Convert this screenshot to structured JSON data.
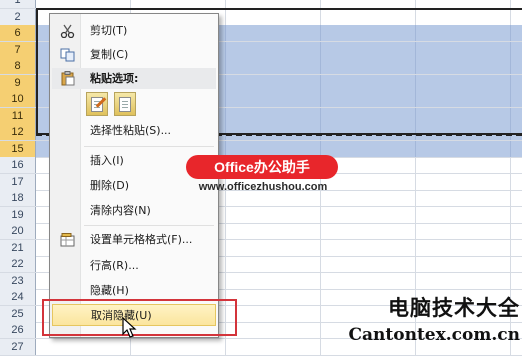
{
  "spreadsheet": {
    "rows": [
      {
        "label": "1",
        "selected": false
      },
      {
        "label": "2",
        "selected": false
      },
      {
        "label": "6",
        "selected": true
      },
      {
        "label": "7",
        "selected": true
      },
      {
        "label": "8",
        "selected": true
      },
      {
        "label": "9",
        "selected": true
      },
      {
        "label": "10",
        "selected": true
      },
      {
        "label": "11",
        "selected": true
      },
      {
        "label": "12",
        "selected": true
      },
      {
        "label": "15",
        "selected": true
      },
      {
        "label": "16",
        "selected": false
      },
      {
        "label": "17",
        "selected": false
      },
      {
        "label": "18",
        "selected": false
      },
      {
        "label": "19",
        "selected": false
      },
      {
        "label": "20",
        "selected": false
      },
      {
        "label": "21",
        "selected": false
      },
      {
        "label": "22",
        "selected": false
      },
      {
        "label": "23",
        "selected": false
      },
      {
        "label": "24",
        "selected": false
      },
      {
        "label": "25",
        "selected": false
      },
      {
        "label": "26",
        "selected": false
      },
      {
        "label": "27",
        "selected": false
      }
    ]
  },
  "context_menu": {
    "cut": "剪切(T)",
    "copy": "复制(C)",
    "paste_options": "粘贴选项:",
    "paste_special": "选择性粘贴(S)...",
    "insert": "插入(I)",
    "delete": "删除(D)",
    "clear_contents": "清除内容(N)",
    "format_cells": "设置单元格格式(F)...",
    "row_height": "行高(R)...",
    "hide": "隐藏(H)",
    "unhide": "取消隐藏(U)"
  },
  "watermarks": {
    "office_badge": "Office办公助手",
    "office_url": "www.officezhushou.com",
    "site_title": "电脑技术大全",
    "site_url": "Cantontex.com.cn"
  },
  "colors": {
    "selection": "#b7c9e6",
    "highlight_box": "#d3343b",
    "badge": "#e8262b"
  }
}
